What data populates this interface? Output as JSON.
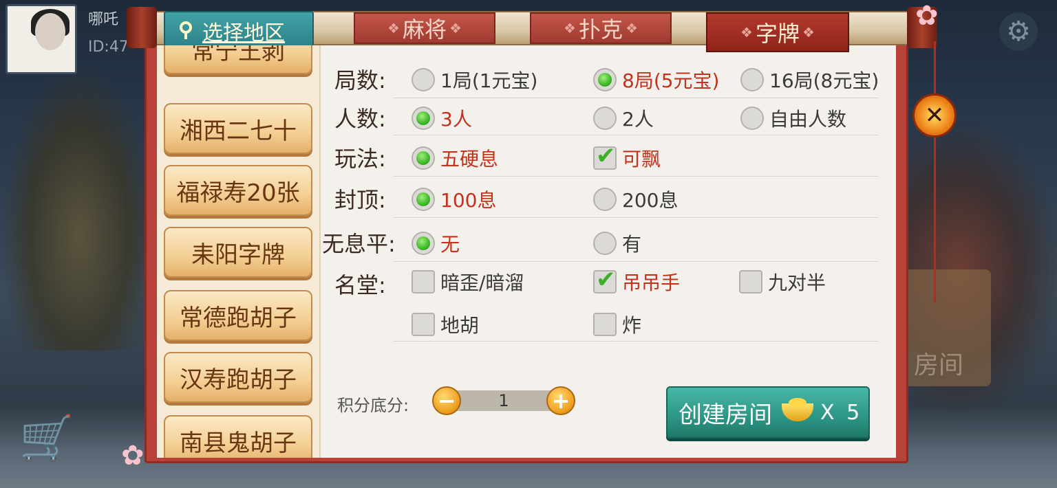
{
  "player": {
    "name": "哪吒",
    "id": "ID:47"
  },
  "tabs": [
    {
      "label": "麻将",
      "active": false
    },
    {
      "label": "扑克",
      "active": false
    },
    {
      "label": "字牌",
      "active": true
    }
  ],
  "region_select": "选择地区",
  "regions": [
    "常宁王剥",
    "湘西二七十",
    "福禄寿20张",
    "耒阳字牌",
    "常德跑胡子",
    "汉寿跑胡子",
    "南县鬼胡子"
  ],
  "rules": {
    "rounds": {
      "label": "局数:",
      "options": [
        "1局(1元宝)",
        "8局(5元宝)",
        "16局(8元宝)"
      ],
      "selected": 1
    },
    "players": {
      "label": "人数:",
      "options": [
        "3人",
        "2人",
        "自由人数"
      ],
      "selected": 0
    },
    "play": {
      "label": "玩法:",
      "options": [
        "五硬息",
        "可飘"
      ]
    },
    "cap": {
      "label": "封顶:",
      "options": [
        "100息",
        "200息"
      ],
      "selected": 0
    },
    "nopoint": {
      "label": "无息平:",
      "options": [
        "无",
        "有"
      ],
      "selected": 0
    },
    "hall": {
      "label": "名堂:",
      "options": [
        "暗歪/暗溜",
        "吊吊手",
        "九对半",
        "地胡",
        "炸"
      ],
      "checked": [
        1
      ]
    }
  },
  "score": {
    "label": "积分底分:",
    "value": "1",
    "minus": "−",
    "plus": "+"
  },
  "create": {
    "label": "创建房间",
    "cost": "X 5"
  },
  "bg_button": "房间",
  "colors": {
    "accent_red": "#c3321d",
    "teal": "#2d9584",
    "gold": "#f0a020"
  }
}
